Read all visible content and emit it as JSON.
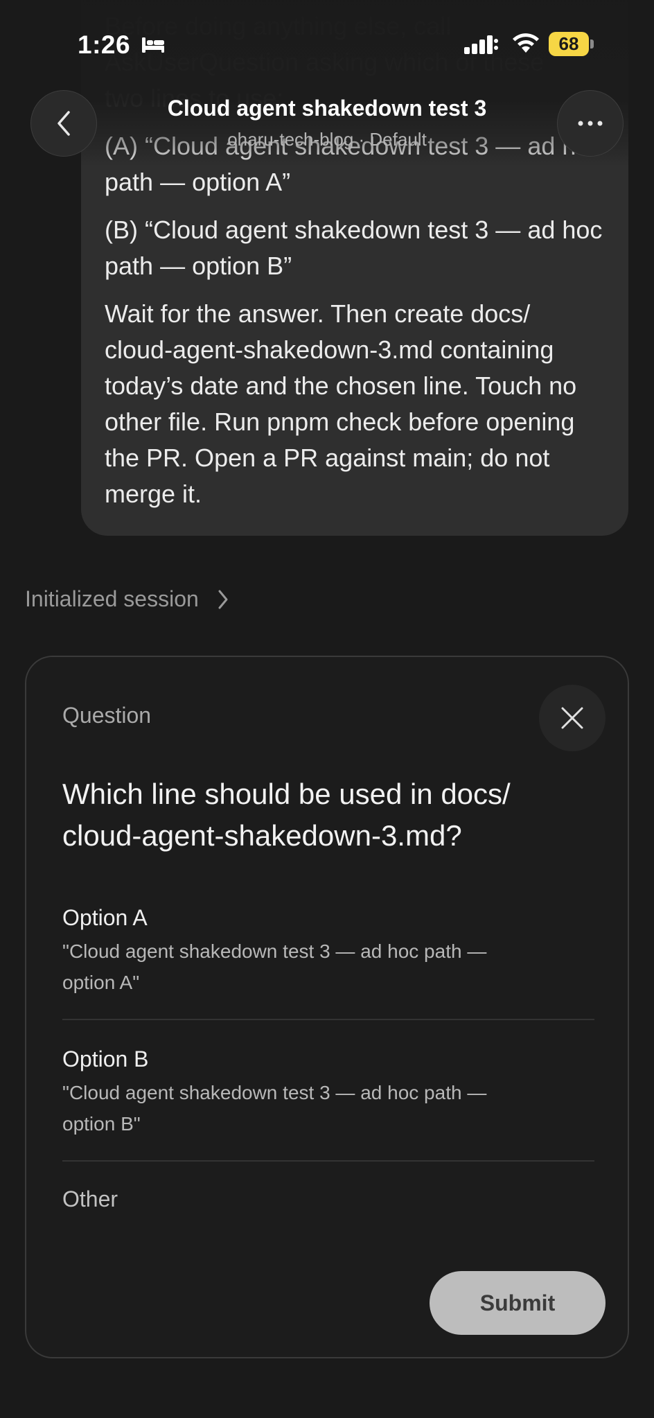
{
  "status_bar": {
    "time": "1:26",
    "battery": "68"
  },
  "header": {
    "title": "Cloud agent shakedown test 3",
    "subtitle": "oharu-tech-blog · Default"
  },
  "message": {
    "faded_lines": [
      "Before doing anything else, call",
      "AskUserQuestion asking which of these",
      "two lines to use:"
    ],
    "option_a_text": "(A) “Cloud agent shakedown test 3 — ad hoc path — option A”",
    "option_b_text": "(B) “Cloud agent shakedown test 3 — ad hoc path — option B”",
    "instructions": "Wait for the answer. Then create docs/ cloud-agent-shakedown-3.md containing today’s date and the chosen line. Touch no other file. Run pnpm check before opening the PR. Open a PR against main; do not merge it."
  },
  "session": {
    "label": "Initialized session"
  },
  "question_card": {
    "label": "Question",
    "question": "Which line should be used in docs/ cloud-agent-shakedown-3.md?",
    "options": [
      {
        "title": "Option A",
        "description": "\"Cloud agent shakedown test 3 — ad hoc path — option A\""
      },
      {
        "title": "Option B",
        "description": "\"Cloud agent shakedown test 3 — ad hoc path — option B\""
      }
    ],
    "other_label": "Other",
    "submit_label": "Submit"
  },
  "colors": {
    "background": "#1a1a1a",
    "bubble": "#2f2f2f",
    "battery": "#f6d645",
    "submit": "#bdbdbd"
  }
}
